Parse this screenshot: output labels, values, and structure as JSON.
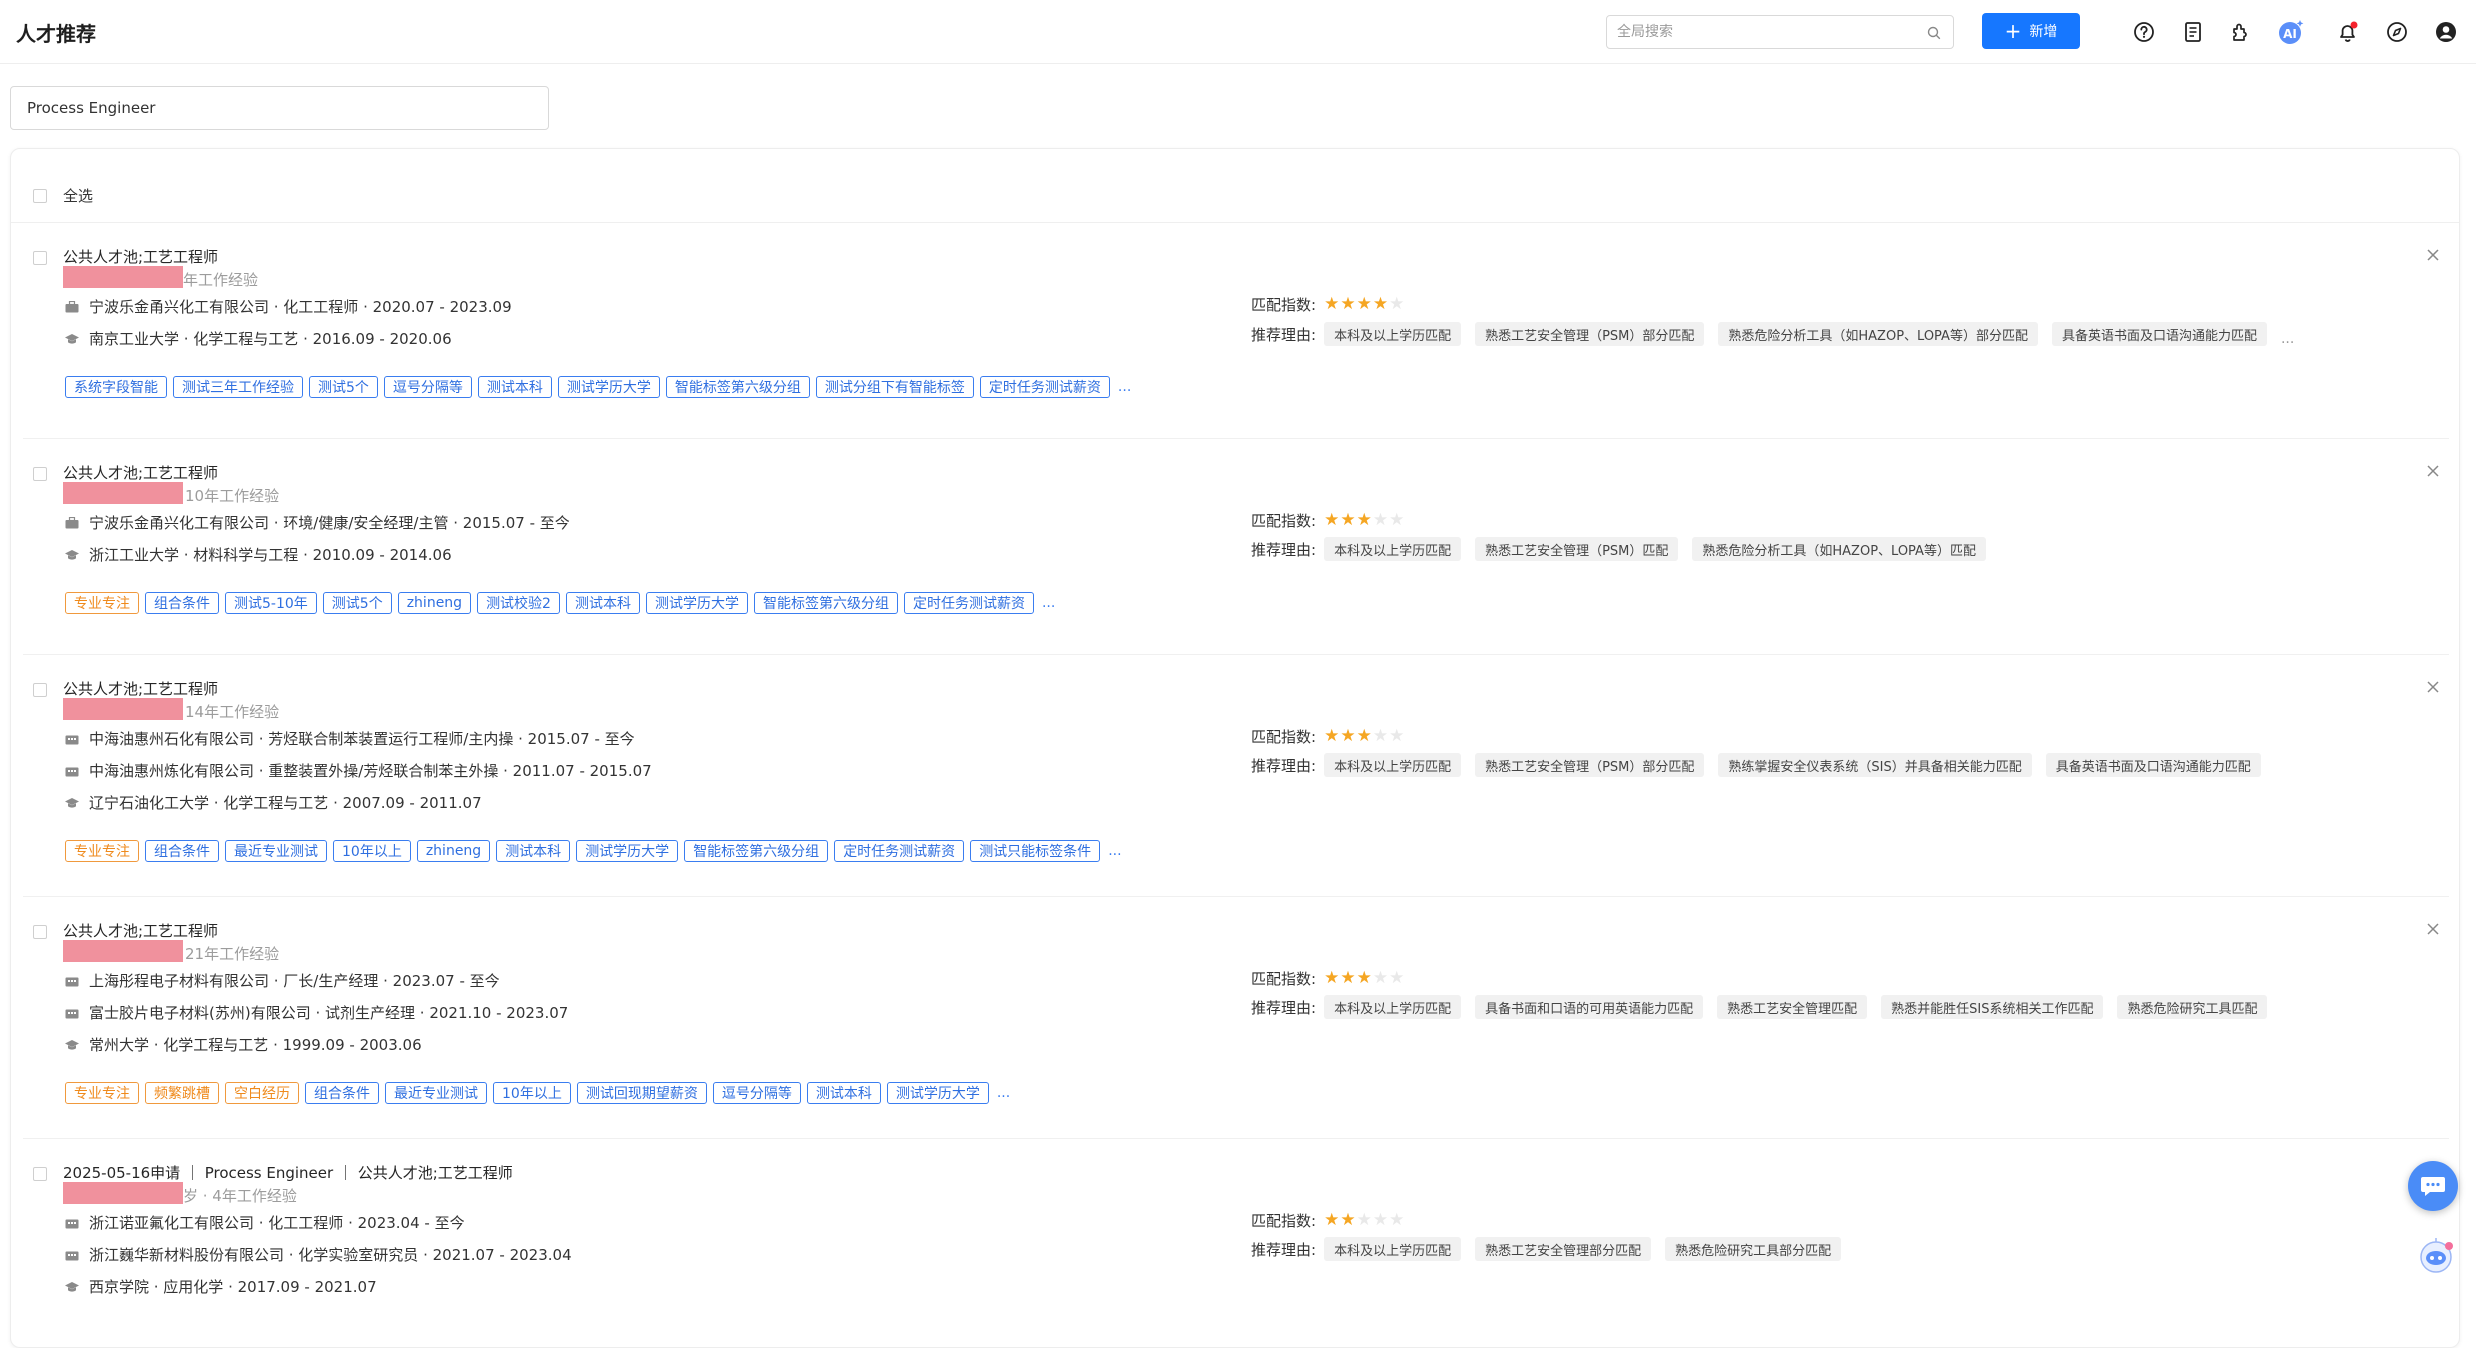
{
  "header": {
    "title": "人才推荐",
    "search_placeholder": "全局搜索",
    "add_label": "新增",
    "icons": [
      "help-icon",
      "document-icon",
      "plugin-icon",
      "ai-icon",
      "bell-icon",
      "compass-icon",
      "user-icon"
    ],
    "accent": "#1677ff"
  },
  "filter": {
    "value": "Process Engineer"
  },
  "list": {
    "select_all_label": "全选",
    "labels": {
      "match_index": "匹配指数:",
      "reason": "推荐理由:"
    },
    "candidates": [
      {
        "source": "公共人才池;工艺工程师",
        "experience": "年工作经验",
        "lines": [
          {
            "icon": "briefcase-icon",
            "text": "宁波乐金甬兴化工有限公司 · 化工工程师 · 2020.07 - 2023.09"
          },
          {
            "icon": "graduation-cap-icon",
            "text": "南京工业大学 · 化学工程与工艺 · 2016.09 - 2020.06"
          }
        ],
        "tags": [
          {
            "text": "系统字段智能",
            "color": "blue"
          },
          {
            "text": "测试三年工作经验",
            "color": "blue"
          },
          {
            "text": "测试5个",
            "color": "blue"
          },
          {
            "text": "逗号分隔等",
            "color": "blue"
          },
          {
            "text": "测试本科",
            "color": "blue"
          },
          {
            "text": "测试学历大学",
            "color": "blue"
          },
          {
            "text": "智能标签第六级分组",
            "color": "blue"
          },
          {
            "text": "测试分组下有智能标签",
            "color": "blue"
          },
          {
            "text": "定时任务测试薪资",
            "color": "blue"
          }
        ],
        "stars": 4,
        "reasons": [
          "本科及以上学历匹配",
          "熟悉工艺安全管理（PSM）部分匹配",
          "熟悉危险分析工具（如HAZOP、LOPA等）部分匹配",
          "具备英语书面及口语沟通能力匹配"
        ],
        "reasons_more": "..."
      },
      {
        "source": "公共人才池;工艺工程师",
        "experience": "10年工作经验",
        "lines": [
          {
            "icon": "briefcase-icon",
            "text": "宁波乐金甬兴化工有限公司 · 环境/健康/安全经理/主管 · 2015.07 - 至今"
          },
          {
            "icon": "graduation-cap-icon",
            "text": "浙江工业大学 · 材料科学与工程 · 2010.09 - 2014.06"
          }
        ],
        "tags": [
          {
            "text": "专业专注",
            "color": "orange"
          },
          {
            "text": "组合条件",
            "color": "blue"
          },
          {
            "text": "测试5-10年",
            "color": "blue"
          },
          {
            "text": "测试5个",
            "color": "blue"
          },
          {
            "text": "zhineng",
            "color": "blue"
          },
          {
            "text": "测试校验2",
            "color": "blue"
          },
          {
            "text": "测试本科",
            "color": "blue"
          },
          {
            "text": "测试学历大学",
            "color": "blue"
          },
          {
            "text": "智能标签第六级分组",
            "color": "blue"
          },
          {
            "text": "定时任务测试薪资",
            "color": "blue"
          }
        ],
        "stars": 3,
        "reasons": [
          "本科及以上学历匹配",
          "熟悉工艺安全管理（PSM）匹配",
          "熟悉危险分析工具（如HAZOP、LOPA等）匹配"
        ],
        "reasons_more": ""
      },
      {
        "source": "公共人才池;工艺工程师",
        "experience": "14年工作经验",
        "lines": [
          {
            "icon": "building-icon",
            "text": "中海油惠州石化有限公司 · 芳烃联合制苯装置运行工程师/主内操 · 2015.07 - 至今"
          },
          {
            "icon": "building-icon",
            "text": "中海油惠州炼化有限公司 · 重整装置外操/芳烃联合制苯主外操 · 2011.07 - 2015.07"
          },
          {
            "icon": "graduation-cap-icon",
            "text": "辽宁石油化工大学 · 化学工程与工艺 · 2007.09 - 2011.07"
          }
        ],
        "tags": [
          {
            "text": "专业专注",
            "color": "orange"
          },
          {
            "text": "组合条件",
            "color": "blue"
          },
          {
            "text": "最近专业测试",
            "color": "blue"
          },
          {
            "text": "10年以上",
            "color": "blue"
          },
          {
            "text": "zhineng",
            "color": "blue"
          },
          {
            "text": "测试本科",
            "color": "blue"
          },
          {
            "text": "测试学历大学",
            "color": "blue"
          },
          {
            "text": "智能标签第六级分组",
            "color": "blue"
          },
          {
            "text": "定时任务测试薪资",
            "color": "blue"
          },
          {
            "text": "测试只能标签条件",
            "color": "blue"
          }
        ],
        "stars": 3,
        "reasons": [
          "本科及以上学历匹配",
          "熟悉工艺安全管理（PSM）部分匹配",
          "熟练掌握安全仪表系统（SIS）并具备相关能力匹配",
          "具备英语书面及口语沟通能力匹配"
        ],
        "reasons_more": ""
      },
      {
        "source": "公共人才池;工艺工程师",
        "experience": "21年工作经验",
        "lines": [
          {
            "icon": "building-icon",
            "text": "上海彤程电子材料有限公司 · 厂长/生产经理 · 2023.07 - 至今"
          },
          {
            "icon": "building-icon",
            "text": "富士胶片电子材料(苏州)有限公司 · 试剂生产经理 · 2021.10 - 2023.07"
          },
          {
            "icon": "graduation-cap-icon",
            "text": "常州大学 · 化学工程与工艺 · 1999.09 - 2003.06"
          }
        ],
        "tags": [
          {
            "text": "专业专注",
            "color": "orange"
          },
          {
            "text": "频繁跳槽",
            "color": "orange"
          },
          {
            "text": "空白经历",
            "color": "orange"
          },
          {
            "text": "组合条件",
            "color": "blue"
          },
          {
            "text": "最近专业测试",
            "color": "blue"
          },
          {
            "text": "10年以上",
            "color": "blue"
          },
          {
            "text": "测试回现期望薪资",
            "color": "blue"
          },
          {
            "text": "逗号分隔等",
            "color": "blue"
          },
          {
            "text": "测试本科",
            "color": "blue"
          },
          {
            "text": "测试学历大学",
            "color": "blue"
          }
        ],
        "stars": 3,
        "reasons": [
          "本科及以上学历匹配",
          "具备书面和口语的可用英语能力匹配",
          "熟悉工艺安全管理匹配",
          "熟悉并能胜任SIS系统相关工作匹配",
          "熟悉危险研究工具匹配"
        ],
        "reasons_more": ""
      },
      {
        "source": "2025-05-16申请 ｜ Process Engineer ｜ 公共人才池;工艺工程师",
        "experience": "岁 · 4年工作经验",
        "lines": [
          {
            "icon": "building-icon",
            "text": "浙江诺亚氟化工有限公司 · 化工工程师 · 2023.04 - 至今"
          },
          {
            "icon": "building-icon",
            "text": "浙江巍华新材料股份有限公司 · 化学实验室研究员 · 2021.07 - 2023.04"
          },
          {
            "icon": "graduation-cap-icon",
            "text": "西京学院 · 应用化学 · 2017.09 - 2021.07"
          }
        ],
        "tags": [],
        "stars": 2,
        "reasons": [
          "本科及以上学历匹配",
          "熟悉工艺安全管理部分匹配",
          "熟悉危险研究工具部分匹配"
        ],
        "reasons_more": ""
      }
    ]
  }
}
